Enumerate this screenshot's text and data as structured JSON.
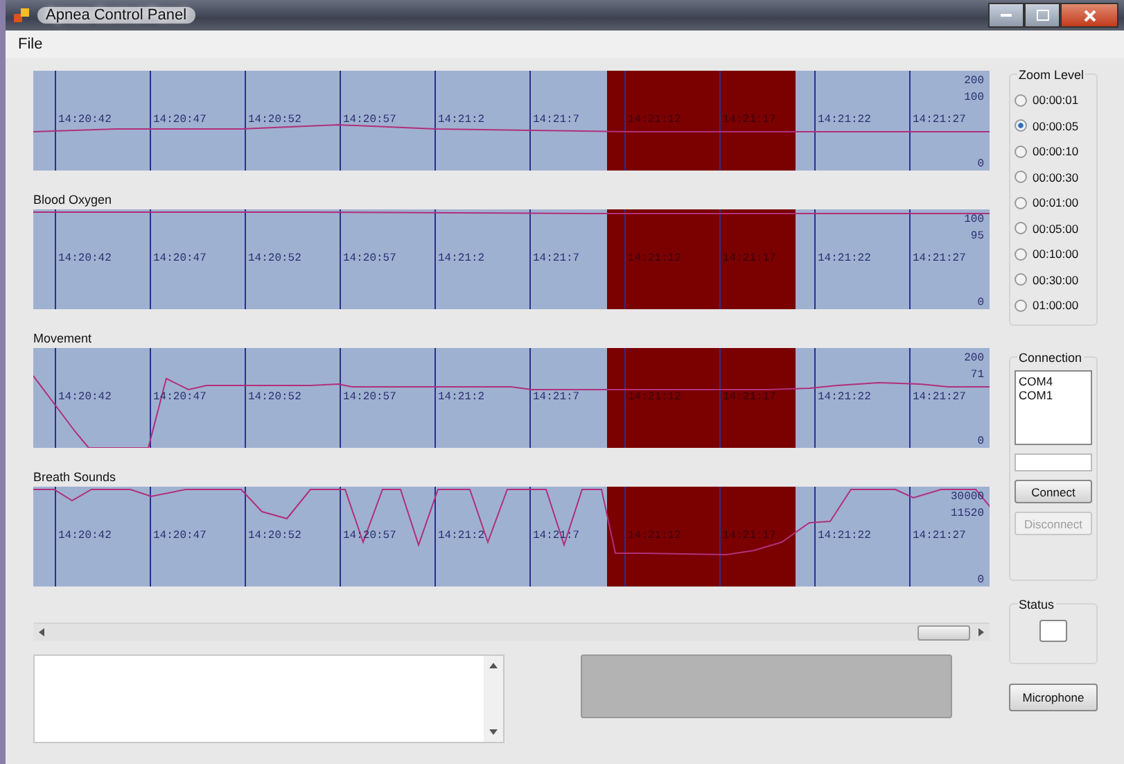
{
  "window": {
    "title": "Apnea Control Panel"
  },
  "menu": [
    "File"
  ],
  "charts": [
    {
      "kind": "flat",
      "times": [
        "14:20:42",
        "14:20:47",
        "14:20:52",
        "14:20:57",
        "14:21:2",
        "14:21:7",
        "14:21:12",
        "14:21:17",
        "14:21:22",
        "14:21:27"
      ],
      "axis": {
        "max": "200",
        "reading": "100",
        "min": "0"
      }
    },
    {
      "title": "Blood Oxygen",
      "kind": "top",
      "times": [
        "14:20:42",
        "14:20:47",
        "14:20:52",
        "14:20:57",
        "14:21:2",
        "14:21:7",
        "14:21:12",
        "14:21:17",
        "14:21:22",
        "14:21:27"
      ],
      "axis": {
        "max": "100",
        "reading": "95",
        "min": "0"
      }
    },
    {
      "title": "Movement",
      "kind": "movement",
      "times": [
        "14:20:42",
        "14:20:47",
        "14:20:52",
        "14:20:57",
        "14:21:2",
        "14:21:7",
        "14:21:12",
        "14:21:17",
        "14:21:22",
        "14:21:27"
      ],
      "axis": {
        "max": "200",
        "reading": "71",
        "min": "0"
      }
    },
    {
      "title": "Breath Sounds",
      "kind": "breath",
      "times": [
        "14:20:42",
        "14:20:47",
        "14:20:52",
        "14:20:57",
        "14:21:2",
        "14:21:7",
        "14:21:12",
        "14:21:17",
        "14:21:22",
        "14:21:27"
      ],
      "axis": {
        "max": "30000",
        "reading": "11520",
        "min": "0"
      }
    }
  ],
  "zoom_level": {
    "title": "Zoom Level",
    "options": [
      {
        "label": "00:00:01",
        "selected": false
      },
      {
        "label": "00:00:05",
        "selected": true
      },
      {
        "label": "00:00:10",
        "selected": false
      },
      {
        "label": "00:00:30",
        "selected": false
      },
      {
        "label": "00:01:00",
        "selected": false
      },
      {
        "label": "00:05:00",
        "selected": false
      },
      {
        "label": "00:10:00",
        "selected": false
      },
      {
        "label": "00:30:00",
        "selected": false
      },
      {
        "label": "01:00:00",
        "selected": false
      }
    ]
  },
  "connection": {
    "title": "Connection",
    "ports": [
      {
        "label": "COM4",
        "selected": false
      },
      {
        "label": "COM1",
        "selected": false
      }
    ],
    "buttons": [
      {
        "label": "Connect",
        "disabled": false
      },
      {
        "label": "Disconnect",
        "disabled": true
      }
    ]
  },
  "status": {
    "title": "Status"
  },
  "microphone_button": "Microphone"
}
